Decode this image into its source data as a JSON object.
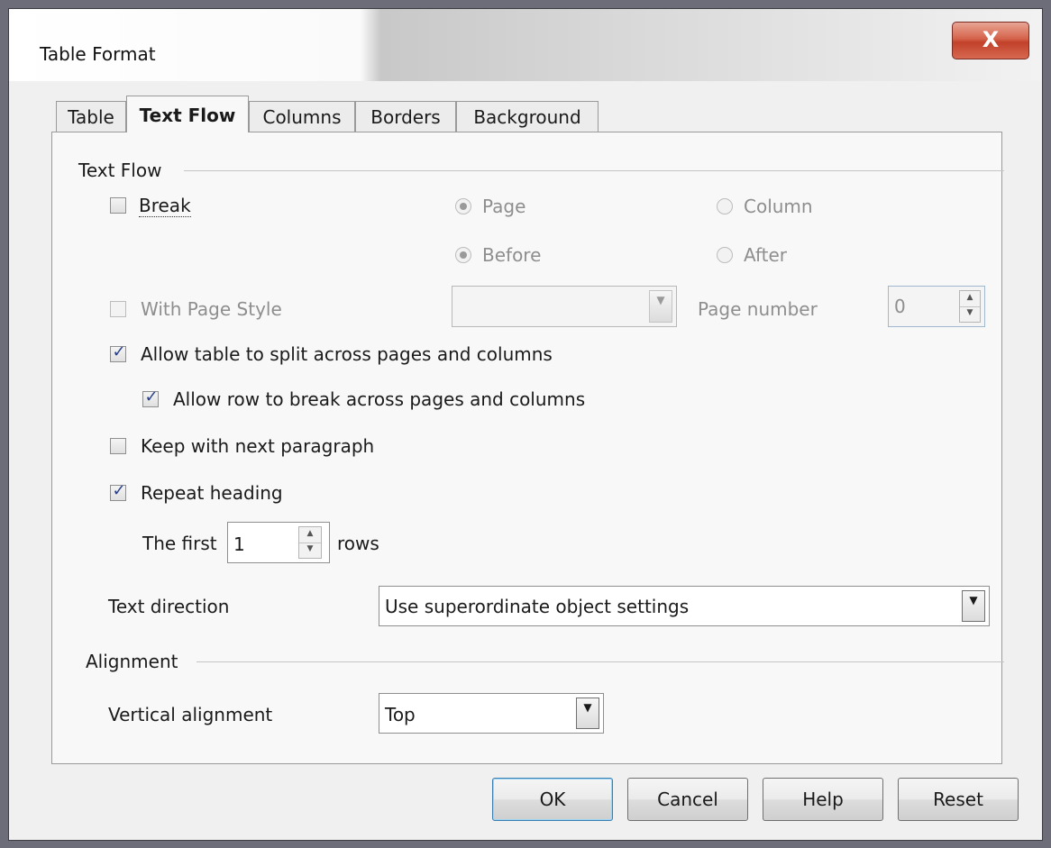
{
  "window": {
    "title": "Table Format",
    "close_glyph": "X"
  },
  "tabs": [
    {
      "label": "Table",
      "active": false
    },
    {
      "label": "Text Flow",
      "active": true
    },
    {
      "label": "Columns",
      "active": false
    },
    {
      "label": "Borders",
      "active": false
    },
    {
      "label": "Background",
      "active": false
    }
  ],
  "text_flow": {
    "group_label": "Text Flow",
    "break": {
      "label": "Break",
      "checked": false
    },
    "radio_page": {
      "label": "Page",
      "selected": true,
      "enabled": false
    },
    "radio_column": {
      "label": "Column",
      "selected": false,
      "enabled": false
    },
    "radio_before": {
      "label": "Before",
      "selected": true,
      "enabled": false
    },
    "radio_after": {
      "label": "After",
      "selected": false,
      "enabled": false
    },
    "with_page_style": {
      "label": "With Page Style",
      "checked": false,
      "enabled": false
    },
    "page_style_select": {
      "value": ""
    },
    "page_number": {
      "label": "Page number",
      "value": "0"
    },
    "allow_split": {
      "label": "Allow table to split across pages and columns",
      "checked": true
    },
    "allow_row_break": {
      "label": "Allow row to break across pages and columns",
      "checked": true
    },
    "keep_with_next": {
      "label": "Keep with next paragraph",
      "checked": false
    },
    "repeat_heading": {
      "label": "Repeat heading",
      "checked": true
    },
    "the_first_label": "The first",
    "rows_value": "1",
    "rows_label": "rows",
    "text_direction": {
      "label": "Text direction",
      "value": "Use superordinate object settings"
    }
  },
  "alignment": {
    "group_label": "Alignment",
    "vertical_alignment": {
      "label": "Vertical alignment",
      "value": "Top"
    }
  },
  "buttons": {
    "ok": "OK",
    "cancel": "Cancel",
    "help": "Help",
    "reset": "Reset"
  },
  "icons": {
    "checkmark": "✓",
    "dropdown_arrow": "▼",
    "spin_up": "▲",
    "spin_down": "▼"
  },
  "colors": {
    "close_button": "#c2412a",
    "check_tick": "#2a3f8a",
    "default_button_border": "#3c7fb1"
  }
}
